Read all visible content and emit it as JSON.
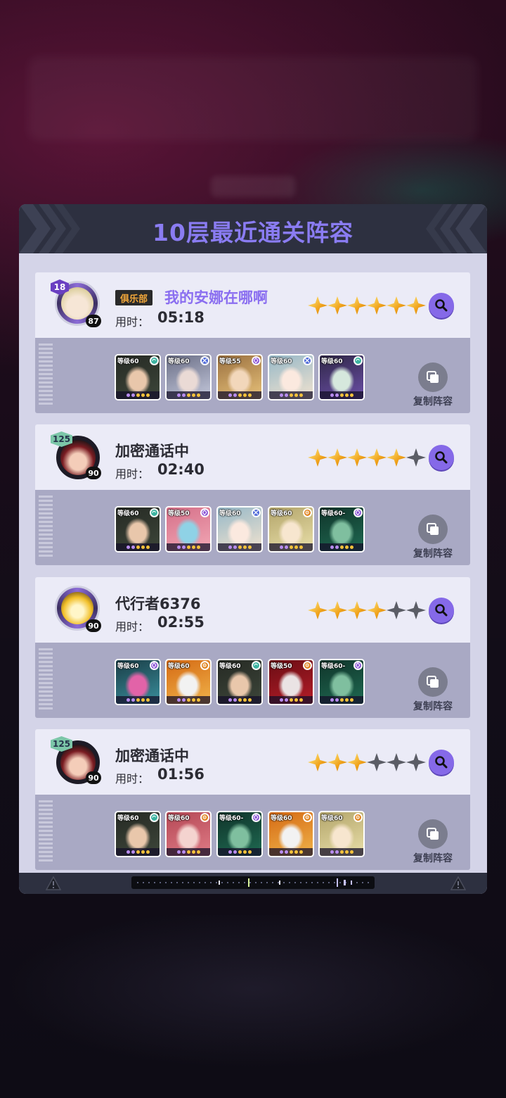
{
  "dialog": {
    "title": "10层最近通关阵容"
  },
  "copy_label": "复制阵容",
  "time_label": "用时：",
  "entries": [
    {
      "club_tag": "俱乐部",
      "name": "我的安娜在哪啊",
      "avatar_level": "18",
      "avatar_sub_level": "87",
      "time": "05:18",
      "stars": 6,
      "team": [
        {
          "level": "等级60",
          "element": "wind",
          "colors": [
            "#262a24",
            "#3d463a",
            "#e9c7ab"
          ]
        },
        {
          "level": "等级60",
          "element": "dark-cross",
          "colors": [
            "#6a6e86",
            "#c5c9dc",
            "#eadad5"
          ]
        },
        {
          "level": "等级55",
          "element": "arcane",
          "colors": [
            "#9a7040",
            "#e8c27a",
            "#f2d7bb"
          ]
        },
        {
          "level": "等级60",
          "element": "dark-cross",
          "colors": [
            "#96b8c8",
            "#f2e3cf",
            "#fbe9df"
          ]
        },
        {
          "level": "等级60",
          "element": "wind",
          "colors": [
            "#2f2746",
            "#6b4fa8",
            "#d6e8dd"
          ]
        }
      ]
    },
    {
      "club_tag": "",
      "name": "加密通话中",
      "avatar_level": "125",
      "avatar_sub_level": "90",
      "time": "02:40",
      "stars": 5,
      "team": [
        {
          "level": "等级60",
          "element": "wind",
          "colors": [
            "#262a24",
            "#3d463a",
            "#e9c7ab"
          ]
        },
        {
          "level": "等级50",
          "element": "arcane",
          "colors": [
            "#d57089",
            "#f2a7b5",
            "#8fd2e6"
          ]
        },
        {
          "level": "等级60",
          "element": "dark-cross",
          "colors": [
            "#96b8c8",
            "#f2e3cf",
            "#fbe9df"
          ]
        },
        {
          "level": "等级60",
          "element": "gear",
          "colors": [
            "#b3a56b",
            "#e9dfa9",
            "#f7e6cf"
          ]
        },
        {
          "level": "等级60-",
          "element": "arcane",
          "colors": [
            "#10342a",
            "#1f6a52",
            "#7fbf9f"
          ]
        }
      ]
    },
    {
      "club_tag": "",
      "name": "代行者6376",
      "avatar_level": "",
      "avatar_sub_level": "90",
      "time": "02:55",
      "stars": 4,
      "team": [
        {
          "level": "等级60",
          "element": "arcane",
          "colors": [
            "#1a3d46",
            "#3a8f9d",
            "#e263a8"
          ]
        },
        {
          "level": "等级60",
          "element": "gear",
          "colors": [
            "#d56a14",
            "#f0b34a",
            "#f2f2f2"
          ]
        },
        {
          "level": "等级60",
          "element": "wind",
          "colors": [
            "#262a24",
            "#3d463a",
            "#e9c7ab"
          ]
        },
        {
          "level": "等级50",
          "element": "gear",
          "colors": [
            "#6a0d14",
            "#b51d28",
            "#eae3e4"
          ]
        },
        {
          "level": "等级60-",
          "element": "arcane",
          "colors": [
            "#10342a",
            "#1f6a52",
            "#7fbf9f"
          ]
        }
      ]
    },
    {
      "club_tag": "",
      "name": "加密通话中",
      "avatar_level": "125",
      "avatar_sub_level": "90",
      "time": "01:56",
      "stars": 3,
      "team": [
        {
          "level": "等级60",
          "element": "wind",
          "colors": [
            "#262a24",
            "#3d463a",
            "#e9c7ab"
          ]
        },
        {
          "level": "等级60",
          "element": "gear",
          "colors": [
            "#b44855",
            "#e07b86",
            "#f4d3cf"
          ]
        },
        {
          "level": "等级60-",
          "element": "arcane",
          "colors": [
            "#10342a",
            "#1f6a52",
            "#7fbf9f"
          ]
        },
        {
          "level": "等级60",
          "element": "gear",
          "colors": [
            "#d56a14",
            "#f0b34a",
            "#f2f2f2"
          ]
        },
        {
          "level": "等级60",
          "element": "gear",
          "colors": [
            "#b3a56b",
            "#e9dfa9",
            "#f7e6cf"
          ]
        }
      ]
    }
  ],
  "colors": {
    "accent_purple": "#8a6ef0",
    "header_bg": "#2d3040",
    "dialog_bg": "#d4d4e8",
    "star_on": "#f0a21a",
    "star_off": "#5b5d66"
  }
}
